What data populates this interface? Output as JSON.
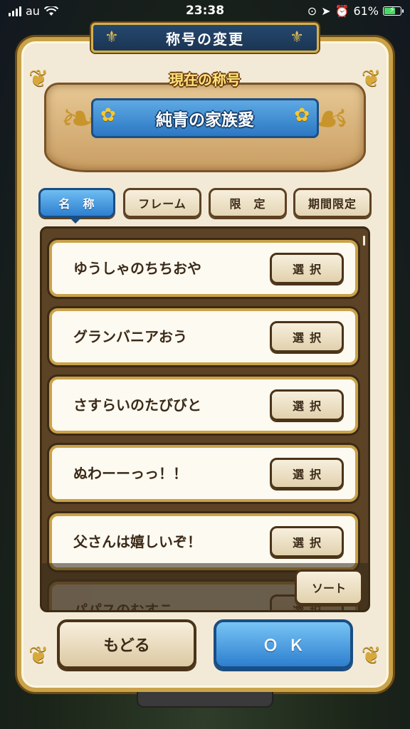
{
  "status_bar": {
    "carrier": "au",
    "time": "23:38",
    "battery_percent": "61%",
    "battery_level": 0.61
  },
  "dialog": {
    "title": "称号の変更",
    "current_label": "現在の称号",
    "current_title": "純青の家族愛"
  },
  "tabs": [
    {
      "label": "名　称",
      "active": true
    },
    {
      "label": "フレーム",
      "active": false
    },
    {
      "label": "限　定",
      "active": false
    },
    {
      "label": "期間限定",
      "active": false
    }
  ],
  "titles": [
    {
      "name": "ゆうしゃのちちおや",
      "button": "選択"
    },
    {
      "name": "グランバニアおう",
      "button": "選択"
    },
    {
      "name": "さすらいのたびびと",
      "button": "選択"
    },
    {
      "name": "ぬわーーっっ！！",
      "button": "選択"
    },
    {
      "name": "父さんは嬉しいぞ！",
      "button": "選択"
    },
    {
      "name": "パパスのむすこ",
      "button": "選択"
    }
  ],
  "sort_label": "ソート",
  "buttons": {
    "back": "もどる",
    "ok": "ＯＫ"
  },
  "colors": {
    "accent_blue": "#2d7fcf",
    "frame_gold": "#c9a24a",
    "panel_brown": "#5c4326"
  }
}
